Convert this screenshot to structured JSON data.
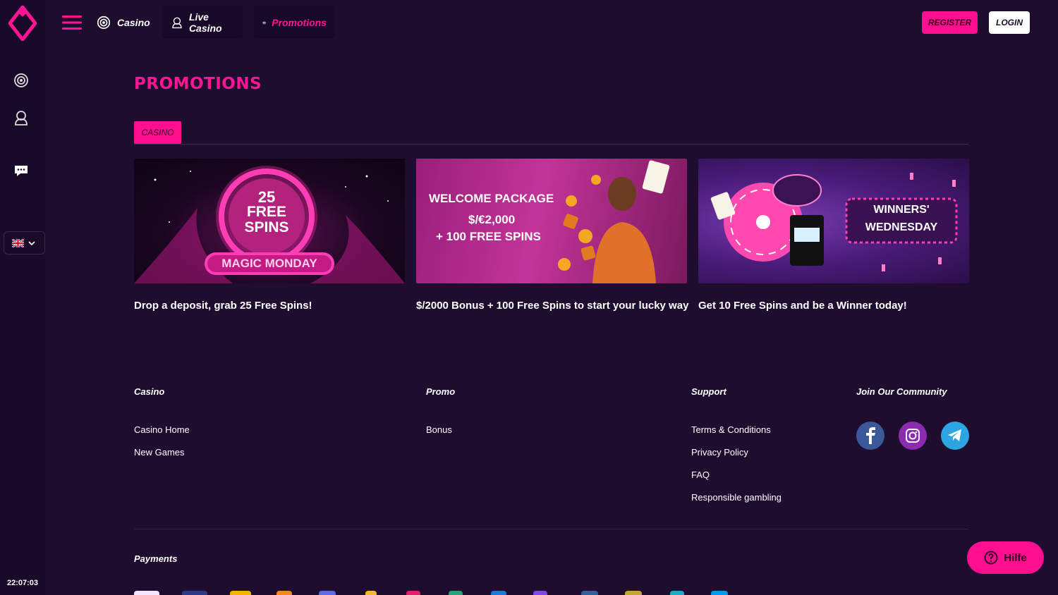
{
  "colors": {
    "accent": "#ff0f8f",
    "background": "#1f0d30",
    "rail": "#1a0a29"
  },
  "nav": {
    "casino": "Casino",
    "live_casino": "Live Casino",
    "promotions": "Promotions",
    "register": "REGISTER",
    "login": "LOGIN"
  },
  "page": {
    "title": "PROMOTIONS",
    "tab": "CASINO"
  },
  "promos": [
    {
      "text": "Drop a deposit, grab 25 Free Spins!",
      "banner_lines": [
        "25",
        "FREE",
        "SPINS"
      ],
      "banner_tag": "MAGIC MONDAY"
    },
    {
      "text": "$/2000 Bonus + 100 Free Spins to start your lucky way",
      "banner_lines": [
        "WELCOME PACKAGE",
        "$/€2,000",
        "+ 100 FREE SPINS"
      ]
    },
    {
      "text": "Get 10 Free Spins and be a Winner today!",
      "banner_lines": [
        "WINNERS'",
        "WEDNESDAY"
      ]
    }
  ],
  "footer": {
    "casino": {
      "heading": "Casino",
      "links": [
        "Casino Home",
        "New Games"
      ]
    },
    "promo": {
      "heading": "Promo",
      "links": [
        "Bonus"
      ]
    },
    "support": {
      "heading": "Support",
      "links": [
        "Terms & Conditions",
        "Privacy Policy",
        "FAQ",
        "Responsible gambling"
      ]
    },
    "community": {
      "heading": "Join Our Community",
      "icons": [
        "facebook-icon",
        "instagram-icon",
        "telegram-icon"
      ]
    },
    "payments": {
      "heading": "Payments"
    }
  },
  "help_button": "Hilfe",
  "clock": "22:07:03",
  "language": "flag-uk-icon"
}
